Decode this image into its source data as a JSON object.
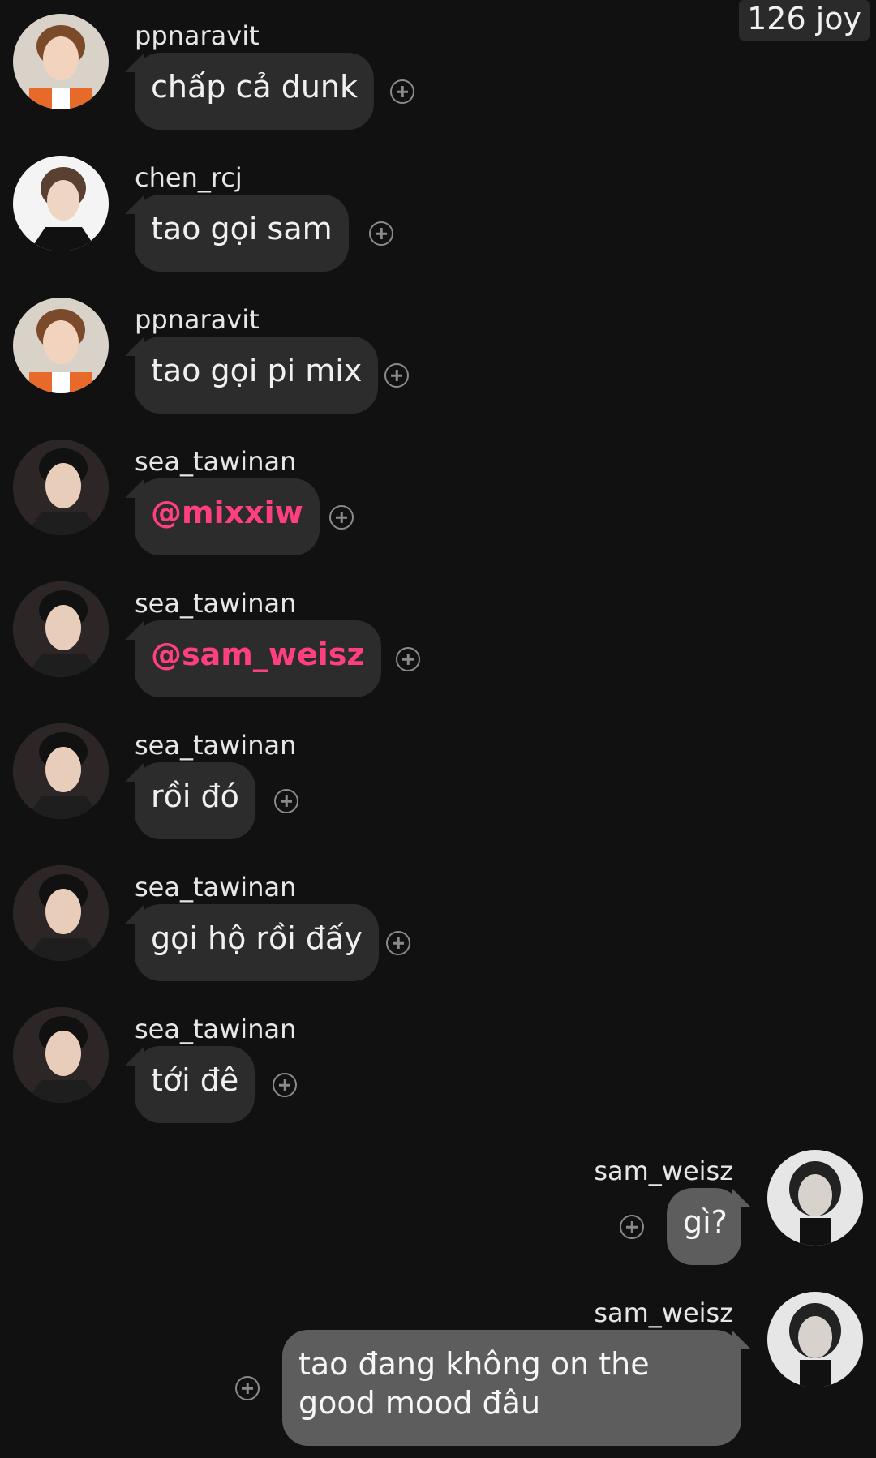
{
  "header": {
    "counter": "126 joy"
  },
  "colors": {
    "background": "#111111",
    "bubble_other": "#2c2c2c",
    "bubble_mine": "#5d5d5d",
    "mention": "#ff3f7e"
  },
  "messages": [
    {
      "user": "ppnaravit",
      "text": "chấp cả dunk",
      "avatar": "avatar-ppnaravit",
      "side": "left"
    },
    {
      "user": "chen_rcj",
      "text": "tao gọi sam",
      "avatar": "avatar-chen_rcj",
      "side": "left"
    },
    {
      "user": "ppnaravit",
      "text": "tao gọi pi mix",
      "avatar": "avatar-ppnaravit",
      "side": "left"
    },
    {
      "user": "sea_tawinan",
      "text": "@mixxiw",
      "avatar": "avatar-sea_tawinan",
      "side": "left",
      "mention": true
    },
    {
      "user": "sea_tawinan",
      "text": "@sam_weisz",
      "avatar": "avatar-sea_tawinan",
      "side": "left",
      "mention": true
    },
    {
      "user": "sea_tawinan",
      "text": "rồi đó",
      "avatar": "avatar-sea_tawinan",
      "side": "left"
    },
    {
      "user": "sea_tawinan",
      "text": "gọi hộ rồi đấy",
      "avatar": "avatar-sea_tawinan",
      "side": "left"
    },
    {
      "user": "sea_tawinan",
      "text": "tới đê",
      "avatar": "avatar-sea_tawinan",
      "side": "left"
    },
    {
      "user": "sam_weisz",
      "text": "gì?",
      "avatar": "avatar-sam_weisz",
      "side": "right"
    },
    {
      "user": "sam_weisz",
      "text": "tao đang không on the good mood đâu",
      "avatar": "avatar-sam_weisz",
      "side": "right"
    }
  ]
}
